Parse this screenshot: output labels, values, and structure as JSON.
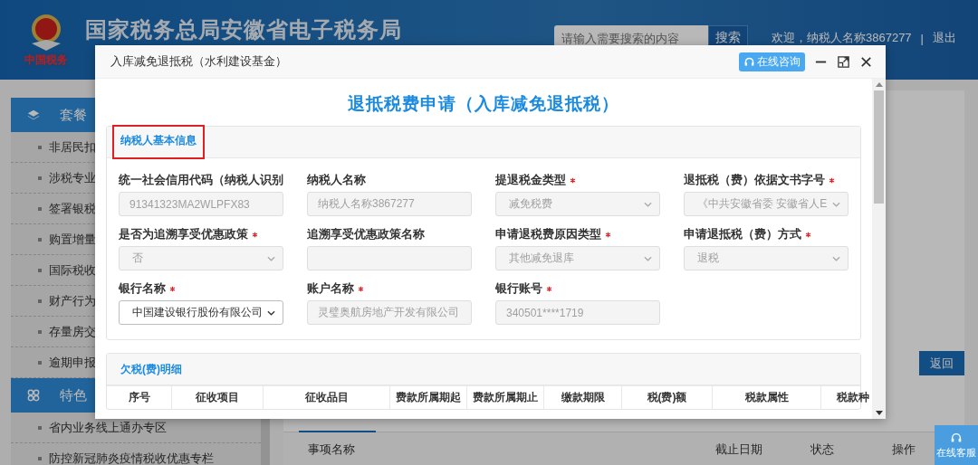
{
  "header": {
    "logo_text": "中国税务",
    "title": "国家税务总局安徽省电子税务局",
    "search": {
      "placeholder": "请输入需要搜索的内容"
    },
    "search_button": "搜索",
    "welcome": "欢迎，纳税人名称3867277",
    "separator": "|",
    "logout": "退出"
  },
  "sidebar": [
    {
      "title": "套餐",
      "items": [
        "非居民扣",
        "涉税专业",
        "签署银税",
        "购置增量",
        "国际税收",
        "财产行为",
        "存量房交",
        "逾期申报"
      ]
    },
    {
      "title": "特色",
      "items": [
        "省内业务线上通办专区",
        "防控新冠肺炎疫情税收优惠专栏"
      ]
    }
  ],
  "main": {
    "back_button": "返回",
    "table_columns": [
      "事项名称",
      "截止日期",
      "状态",
      "操作"
    ]
  },
  "float_button": "在线客服",
  "dialog": {
    "title": "入库减免退抵税（水利建设基金）",
    "consult_button": "在线咨询",
    "heading": "退抵税费申请（入库减免退抵税）",
    "sections": [
      {
        "title": "纳税人基本信息",
        "highlighted": true,
        "fields": [
          {
            "label": "统一社会信用代码（纳税人识别",
            "required": false,
            "kind": "input",
            "value": "91341323MA2WLPFX83",
            "disabled": true
          },
          {
            "label": "纳税人名称",
            "required": false,
            "kind": "input",
            "value": "纳税人名称3867277",
            "disabled": true
          },
          {
            "label": "提退税金类型",
            "required": true,
            "kind": "select",
            "value": "减免税费",
            "disabled": true
          },
          {
            "label": "退抵税（费）依据文书字号",
            "required": true,
            "kind": "select",
            "value": "《中共安徽省委 安徽省人E",
            "disabled": true
          },
          {
            "label": "是否为追溯享受优惠政策",
            "required": true,
            "kind": "select",
            "value": "否",
            "disabled": true
          },
          {
            "label": "追溯享受优惠政策名称",
            "required": false,
            "kind": "input",
            "disabled": true
          },
          {
            "label": "申请退税费原因类型",
            "required": true,
            "kind": "select",
            "value": "其他减免退库",
            "disabled": true
          },
          {
            "label": "申请退抵税（费）方式",
            "required": true,
            "kind": "select",
            "value": "退税",
            "disabled": true
          },
          {
            "label": "银行名称",
            "required": true,
            "kind": "select",
            "value": "中国建设银行股份有限公司",
            "disabled": false
          },
          {
            "label": "账户名称",
            "required": true,
            "kind": "input",
            "value": "灵璧奥航房地产开发有限公司",
            "disabled": true
          },
          {
            "label": "银行账号",
            "required": true,
            "kind": "input",
            "value": "340501****1719",
            "disabled": true
          }
        ]
      },
      {
        "title": "欠税(费)明细",
        "highlighted": false,
        "table_columns": [
          "序号",
          "征收项目",
          "征收品目",
          "费款所属期起",
          "费款所属期止",
          "缴款期限",
          "税(费)额",
          "税款属性",
          "税款种"
        ]
      }
    ]
  }
}
